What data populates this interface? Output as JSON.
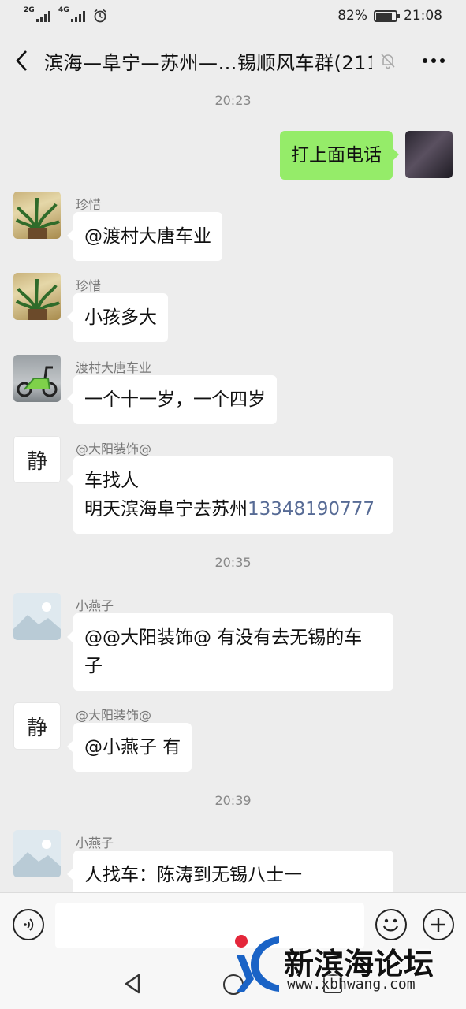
{
  "status_bar": {
    "signal1": "2G",
    "signal2": "4G",
    "battery": "82%",
    "battery_level": 0.82,
    "time": "21:08"
  },
  "header": {
    "title": "滨海—阜宁—苏州—…锡顺风车群(211)",
    "icons": [
      "back-arrow-icon",
      "mute-bell-icon",
      "more-icon"
    ]
  },
  "messages": [
    {
      "type": "time",
      "text": "20:23"
    },
    {
      "type": "mine",
      "text": "打上面电话"
    },
    {
      "type": "other",
      "sender": "珍惜",
      "text": "@渡村大唐车业"
    },
    {
      "type": "other",
      "sender": "珍惜",
      "text": "小孩多大"
    },
    {
      "type": "other",
      "sender": "渡村大唐车业",
      "text": "一个十一岁，一个四岁"
    },
    {
      "type": "other",
      "sender": "@大阳装饰@",
      "line1": "车找人",
      "line2": "明天滨海阜宁去苏州",
      "phone": "13348190777",
      "avatar_text": "静"
    },
    {
      "type": "time",
      "text": "20:35"
    },
    {
      "type": "other",
      "sender": "小燕子",
      "line1": "@@大阳装饰@ 有没有去无锡的车",
      "line2": "子"
    },
    {
      "type": "other",
      "sender": "@大阳装饰@",
      "text": "@小燕子  有",
      "avatar_text": "静"
    },
    {
      "type": "time",
      "text": "20:39"
    },
    {
      "type": "other",
      "sender": "小燕子",
      "text": "人找车：陈涛到无锡八士一"
    }
  ],
  "input_bar": {
    "placeholder": "",
    "icons": [
      "voice-icon",
      "emoji-icon",
      "plus-icon"
    ]
  },
  "watermark": {
    "name": "新滨海论坛",
    "url": "www.xbhwang.com"
  },
  "colors": {
    "background": "#ededed",
    "mine_bubble": "#95ec69",
    "other_bubble": "#ffffff",
    "phone_link": "#576b95"
  }
}
